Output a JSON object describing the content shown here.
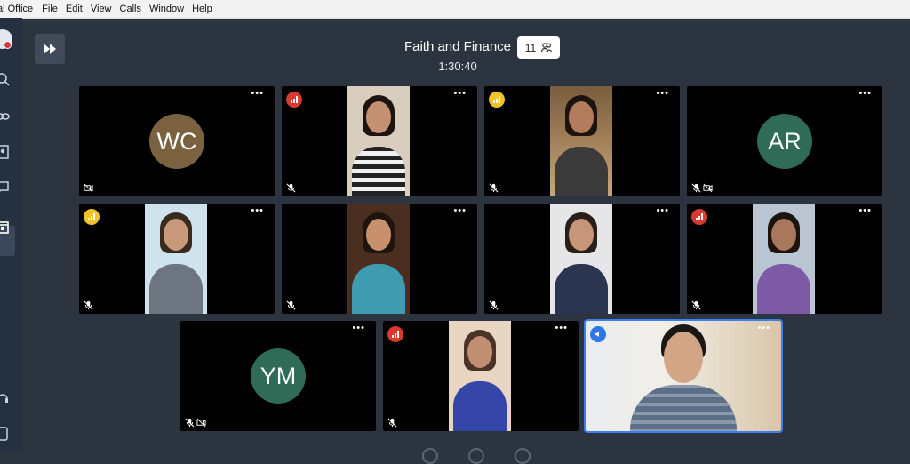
{
  "menubar": {
    "app_name": "al Office",
    "items": [
      "File",
      "Edit",
      "View",
      "Calls",
      "Window",
      "Help"
    ]
  },
  "sidebar": {
    "icons": [
      "avatar",
      "search-icon",
      "link-icon",
      "contacts-icon",
      "chat-icon",
      "calendar-icon",
      "headset-icon",
      "phone-icon"
    ],
    "active": "calendar-icon"
  },
  "meeting": {
    "title": "Faith and Finance",
    "elapsed": "1:30:40",
    "participant_count": "11"
  },
  "colors": {
    "background": "#2c3440",
    "speaking_border": "#3c7ff0",
    "wc_avatar": "#7a6240",
    "ar_avatar": "#2f6b56",
    "ym_avatar": "#2f6b56"
  },
  "tiles": [
    {
      "initials": "WC",
      "video": false,
      "signal": null,
      "muted": false,
      "camera_off": true
    },
    {
      "initials": null,
      "video": true,
      "signal": "red",
      "muted": true,
      "camera_off": false
    },
    {
      "initials": null,
      "video": true,
      "signal": "yellow",
      "muted": true,
      "camera_off": false
    },
    {
      "initials": "AR",
      "video": false,
      "signal": null,
      "muted": true,
      "camera_off": true
    },
    {
      "initials": null,
      "video": true,
      "signal": "yellow",
      "muted": true,
      "camera_off": false
    },
    {
      "initials": null,
      "video": true,
      "signal": null,
      "muted": true,
      "camera_off": false
    },
    {
      "initials": null,
      "video": true,
      "signal": null,
      "muted": true,
      "camera_off": false
    },
    {
      "initials": null,
      "video": true,
      "signal": "red",
      "muted": true,
      "camera_off": false
    },
    {
      "initials": "YM",
      "video": false,
      "signal": null,
      "muted": true,
      "camera_off": true
    },
    {
      "initials": null,
      "video": true,
      "signal": "red",
      "muted": true,
      "camera_off": false
    },
    {
      "initials": null,
      "video": true,
      "signal": "blue",
      "muted": false,
      "camera_off": false,
      "speaking": true
    }
  ]
}
